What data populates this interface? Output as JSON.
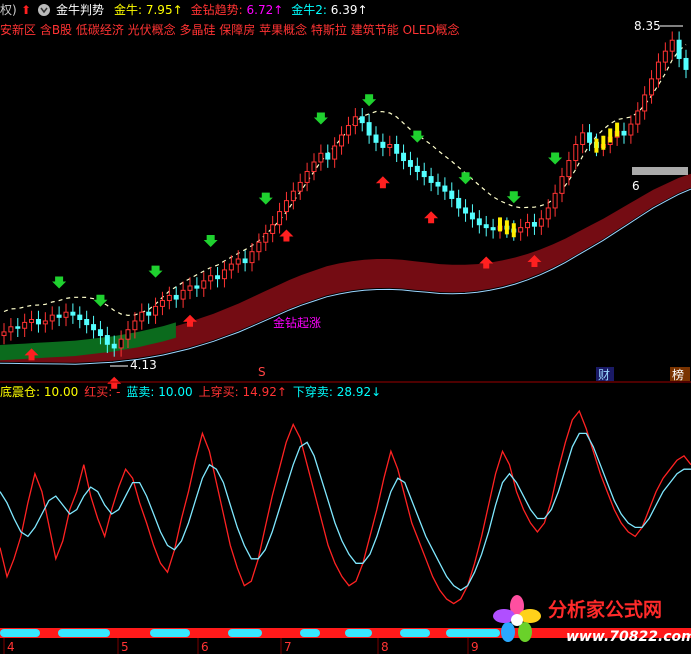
{
  "header": {
    "prefix": "权)",
    "indicator": "金牛判势",
    "items": [
      {
        "label": "金牛: ",
        "value": "7.95",
        "arrow": "↑",
        "label_color": "#ffff00",
        "value_color": "#ffff00"
      },
      {
        "label": "金钻趋势: ",
        "value": "6.72",
        "arrow": "↑",
        "label_color": "#ff3333",
        "value_color": "#ff00ff"
      },
      {
        "label": "金牛2: ",
        "value": "6.39",
        "arrow": "↑",
        "label_color": "#00ffff",
        "value_color": "#ffffff"
      }
    ]
  },
  "concepts": "安新区 含B股 低碳经济 光伏概念 多晶硅 保障房 苹果概念 特斯拉 建筑节能 OLED概念",
  "price_labels": {
    "high": "8.35",
    "low": "4.13",
    "mid_tag": "6",
    "trend_label": "金钻起涨"
  },
  "right_tags": [
    "财",
    "榜"
  ],
  "sub_header": {
    "items": [
      {
        "label": "底震仓: ",
        "value": "10.00",
        "color": "#ffff00"
      },
      {
        "label": "红买: ",
        "value": "-",
        "color": "#ff3333"
      },
      {
        "label": "蓝卖: ",
        "value": "10.00",
        "color": "#00ffff"
      },
      {
        "label": "上穿买: ",
        "value": "14.92",
        "arrow": "↑",
        "color": "#ff3333"
      },
      {
        "label": "下穿卖: ",
        "value": "28.92",
        "arrow": "↓",
        "color": "#00ffff"
      }
    ]
  },
  "time_axis": [
    "4",
    "5",
    "6",
    "7",
    "8",
    "9"
  ],
  "watermark": {
    "title": "分析家公式网",
    "url": "www.70822.com"
  },
  "colors": {
    "up": "#ff3333",
    "down": "#54ffff",
    "ribbon_top": "#7a0d14",
    "ribbon_green": "#0b6b1d",
    "dash_line": "#ffffcc",
    "low_line": "#9ad6ff",
    "osc_red": "#ff2222",
    "osc_cyan": "#7fe8ff",
    "yellow": "#ffee00",
    "magenta": "#ff00ff",
    "grid": "#7a0000"
  },
  "chart_data": {
    "type": "candlestick",
    "price_ylim": [
      3.8,
      8.6
    ],
    "close": [
      4.35,
      4.42,
      4.4,
      4.48,
      4.52,
      4.46,
      4.5,
      4.58,
      4.55,
      4.62,
      4.58,
      4.52,
      4.45,
      4.38,
      4.3,
      4.18,
      4.13,
      4.25,
      4.38,
      4.5,
      4.62,
      4.58,
      4.7,
      4.78,
      4.85,
      4.8,
      4.92,
      4.98,
      4.95,
      5.05,
      5.12,
      5.08,
      5.2,
      5.28,
      5.35,
      5.3,
      5.45,
      5.58,
      5.7,
      5.82,
      6.0,
      6.15,
      6.28,
      6.4,
      6.55,
      6.68,
      6.8,
      6.72,
      6.9,
      7.05,
      7.18,
      7.3,
      7.22,
      7.05,
      6.95,
      6.88,
      6.92,
      6.8,
      6.7,
      6.62,
      6.55,
      6.48,
      6.4,
      6.35,
      6.28,
      6.18,
      6.05,
      5.98,
      5.9,
      5.82,
      5.78,
      5.75,
      5.8,
      5.76,
      5.72,
      5.78,
      5.85,
      5.8,
      5.9,
      6.05,
      6.25,
      6.48,
      6.7,
      6.92,
      7.08,
      6.95,
      6.88,
      6.92,
      7.02,
      7.1,
      7.05,
      7.2,
      7.38,
      7.6,
      7.82,
      8.05,
      8.2,
      8.35,
      8.1,
      7.95
    ],
    "trend_upper": [
      4.12,
      4.13,
      4.14,
      4.15,
      4.16,
      4.17,
      4.18,
      4.2,
      4.22,
      4.24,
      4.27,
      4.3,
      4.34,
      4.38,
      4.43,
      4.48,
      4.54,
      4.6,
      4.67,
      4.74,
      4.82,
      4.9,
      4.98,
      5.06,
      5.13,
      5.19,
      5.25,
      5.29,
      5.32,
      5.34,
      5.35,
      5.35,
      5.34,
      5.32,
      5.3,
      5.28,
      5.27,
      5.27,
      5.28,
      5.3,
      5.33,
      5.37,
      5.42,
      5.48,
      5.55,
      5.63,
      5.72,
      5.81,
      5.9,
      6.0,
      6.1,
      6.2,
      6.3,
      6.38,
      6.46,
      6.52
    ],
    "osc_red": [
      35,
      22,
      30,
      40,
      55,
      68,
      60,
      45,
      30,
      38,
      52,
      60,
      72,
      58,
      48,
      40,
      52,
      62,
      70,
      66,
      55,
      46,
      36,
      28,
      24,
      34,
      48,
      60,
      74,
      86,
      78,
      64,
      50,
      36,
      26,
      18,
      20,
      30,
      44,
      58,
      70,
      82,
      90,
      84,
      72,
      60,
      48,
      36,
      28,
      22,
      18,
      20,
      28,
      40,
      52,
      66,
      78,
      70,
      58,
      46,
      38,
      30,
      22,
      16,
      12,
      10,
      12,
      18,
      28,
      40,
      54,
      68,
      78,
      72,
      60,
      52,
      46,
      42,
      46,
      56,
      70,
      82,
      92,
      96,
      88,
      78,
      68,
      60,
      52,
      46,
      42,
      40,
      44,
      52,
      60,
      66,
      70,
      74,
      76,
      72
    ],
    "osc_cyan": [
      60,
      55,
      48,
      42,
      40,
      44,
      50,
      56,
      58,
      54,
      50,
      52,
      58,
      62,
      60,
      54,
      50,
      52,
      58,
      64,
      64,
      58,
      50,
      42,
      36,
      34,
      38,
      46,
      56,
      66,
      72,
      70,
      64,
      54,
      44,
      36,
      30,
      30,
      34,
      42,
      52,
      62,
      72,
      80,
      82,
      76,
      66,
      56,
      46,
      38,
      32,
      28,
      28,
      32,
      40,
      50,
      60,
      66,
      64,
      56,
      48,
      40,
      34,
      28,
      22,
      18,
      16,
      18,
      24,
      32,
      42,
      54,
      64,
      68,
      64,
      58,
      52,
      48,
      48,
      52,
      60,
      70,
      80,
      86,
      86,
      80,
      72,
      64,
      56,
      50,
      46,
      44,
      44,
      48,
      54,
      60,
      64,
      68,
      70,
      70
    ]
  }
}
